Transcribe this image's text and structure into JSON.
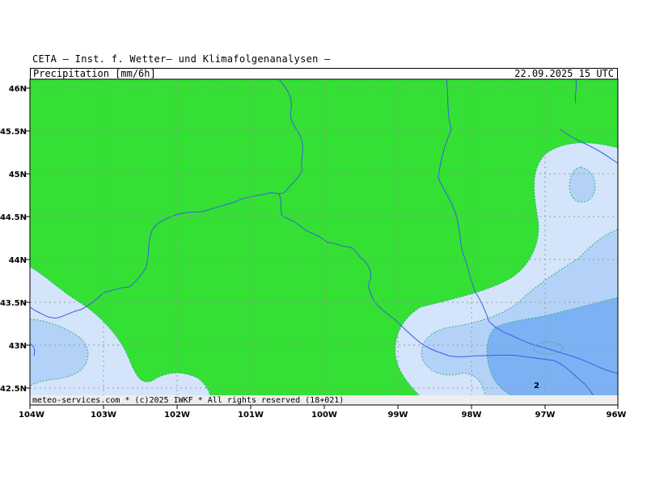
{
  "header": {
    "title": "CETA — Inst. f. Wetter— und Klimafolgenanalysen —",
    "parameter": "Precipitation_[mm/6h]",
    "valid_time": "22.09.2025 15 UTC"
  },
  "axes": {
    "lat_labels": [
      "46N",
      "45.5N",
      "45N",
      "44.5N",
      "44N",
      "43.5N",
      "43N",
      "42.5N"
    ],
    "lon_labels": [
      "104W",
      "103W",
      "102W",
      "101W",
      "100W",
      "99W",
      "98W",
      "97W",
      "96W"
    ]
  },
  "legend_levels": {
    "contour_label": "2"
  },
  "colors": {
    "no_precip": "#33e033",
    "level_light": "#d4e4fa",
    "level_mid": "#b4d2f8",
    "level_high": "#7cb2f4",
    "river": "#3a5ee0",
    "grid": "#9a9a9a",
    "contour": "#2fb37a"
  },
  "footer": {
    "credit": "meteo-services.com * (c)2025 IWKF * All rights reserved (18+021)"
  }
}
